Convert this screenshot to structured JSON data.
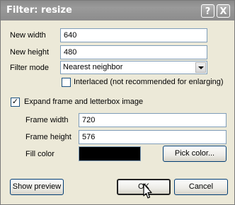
{
  "window": {
    "title": "Filter: resize",
    "help_label": "?",
    "close_label": "X"
  },
  "fields": {
    "new_width_label": "New width",
    "new_width_value": "640",
    "new_height_label": "New height",
    "new_height_value": "480",
    "filter_mode_label": "Filter mode",
    "filter_mode_value": "Nearest neighbor",
    "interlaced_label": "Interlaced (not recommended for enlarging)",
    "interlaced_checked": false,
    "expand_label": "Expand frame and letterbox image",
    "expand_checked": true,
    "expand_check_glyph": "✓",
    "frame_width_label": "Frame width",
    "frame_width_value": "720",
    "frame_height_label": "Frame height",
    "frame_height_value": "576",
    "fill_color_label": "Fill color",
    "fill_color": "#000000"
  },
  "buttons": {
    "pick_color": "Pick color...",
    "show_preview": "Show preview",
    "ok": "OK",
    "cancel": "Cancel"
  }
}
